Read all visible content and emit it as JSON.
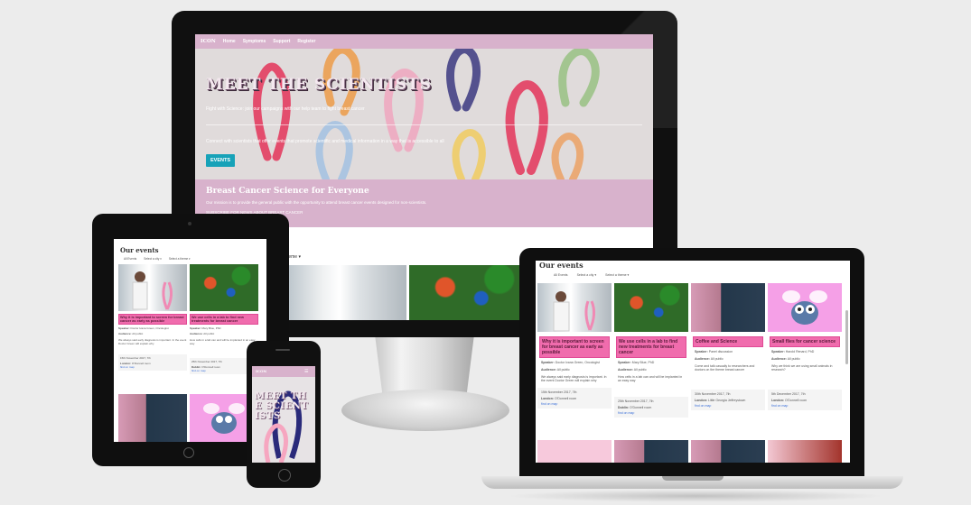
{
  "site": {
    "brand": "ICON",
    "nav": [
      "Home",
      "Symptoms",
      "Support",
      "Register"
    ]
  },
  "hero": {
    "title": "MEET THE SCIENTISTS",
    "subtitle": "Fight with Science: join our campaigns with our help team to fight breast cancer",
    "description": "Connect with scientists that offer events that promote scientific and medical information in a way that is accessible to all",
    "button": "EVENTS"
  },
  "band": {
    "title": "Breast Cancer Science for Everyone",
    "text": "Our mission is to provide the general public with the opportunity to attend breast cancer events designed for non-scientists.",
    "link": "SUBSCRIBE FOR NEWS ABOUT BREAST CANCER"
  },
  "filters": {
    "all": "All Events",
    "city": "Select a city",
    "theme": "Select a theme",
    "theme_partial": "a theme"
  },
  "events_title": "Our events",
  "cards": [
    {
      "title": "Why it is important to screen for breast cancer as early as possible",
      "speaker_label": "Speaker:",
      "speaker": "Doctor Ivana Green, Oncologist",
      "audience_label": "Audience:",
      "audience": "All public",
      "body": "We always said early diagnosis is important. In the event Doctor Green will explain why",
      "date": "15th November 2017, 7th",
      "location_label": "London:",
      "location": "O'Donnell room",
      "link": "find on map"
    },
    {
      "title": "We use cells in a lab to find new treatments for breast cancer",
      "speaker_label": "Speaker:",
      "speaker": "Mary Blue, PhD",
      "audience_label": "Audience:",
      "audience": "All public",
      "body": "How cells in a lab can and will be implanted in an easy way",
      "date": "25th November 2017, 7th",
      "location_label": "Dublin:",
      "location": "O'Donnell room",
      "link": "find on map"
    },
    {
      "title": "Coffee and Science",
      "speaker_label": "Speaker:",
      "speaker": "Panel discussion",
      "audience_label": "Audience:",
      "audience": "All public",
      "body": "Come and talk casually to researchers and doctors on the theme breast cancer",
      "date": "30th November 2017, 7th",
      "location_label": "London:",
      "location": "Little Georgia Jeffreystown",
      "link": "find on map"
    },
    {
      "title": "Small flies for cancer science",
      "speaker_label": "Speaker:",
      "speaker": "Harold Renard, PhD",
      "audience_label": "Audience:",
      "audience": "All public",
      "body": "Why we think we are using small animals in research?",
      "date": "5th December 2017, 7th",
      "location_label": "London:",
      "location": "O'Donnell room",
      "link": "find on map"
    }
  ],
  "phone": {
    "hero_title": "MEET THE SCIENTISTS"
  },
  "colors": {
    "nav_pink": "#d8b2cc",
    "card_pink": "#f06cad",
    "button_teal": "#17a2b8"
  }
}
